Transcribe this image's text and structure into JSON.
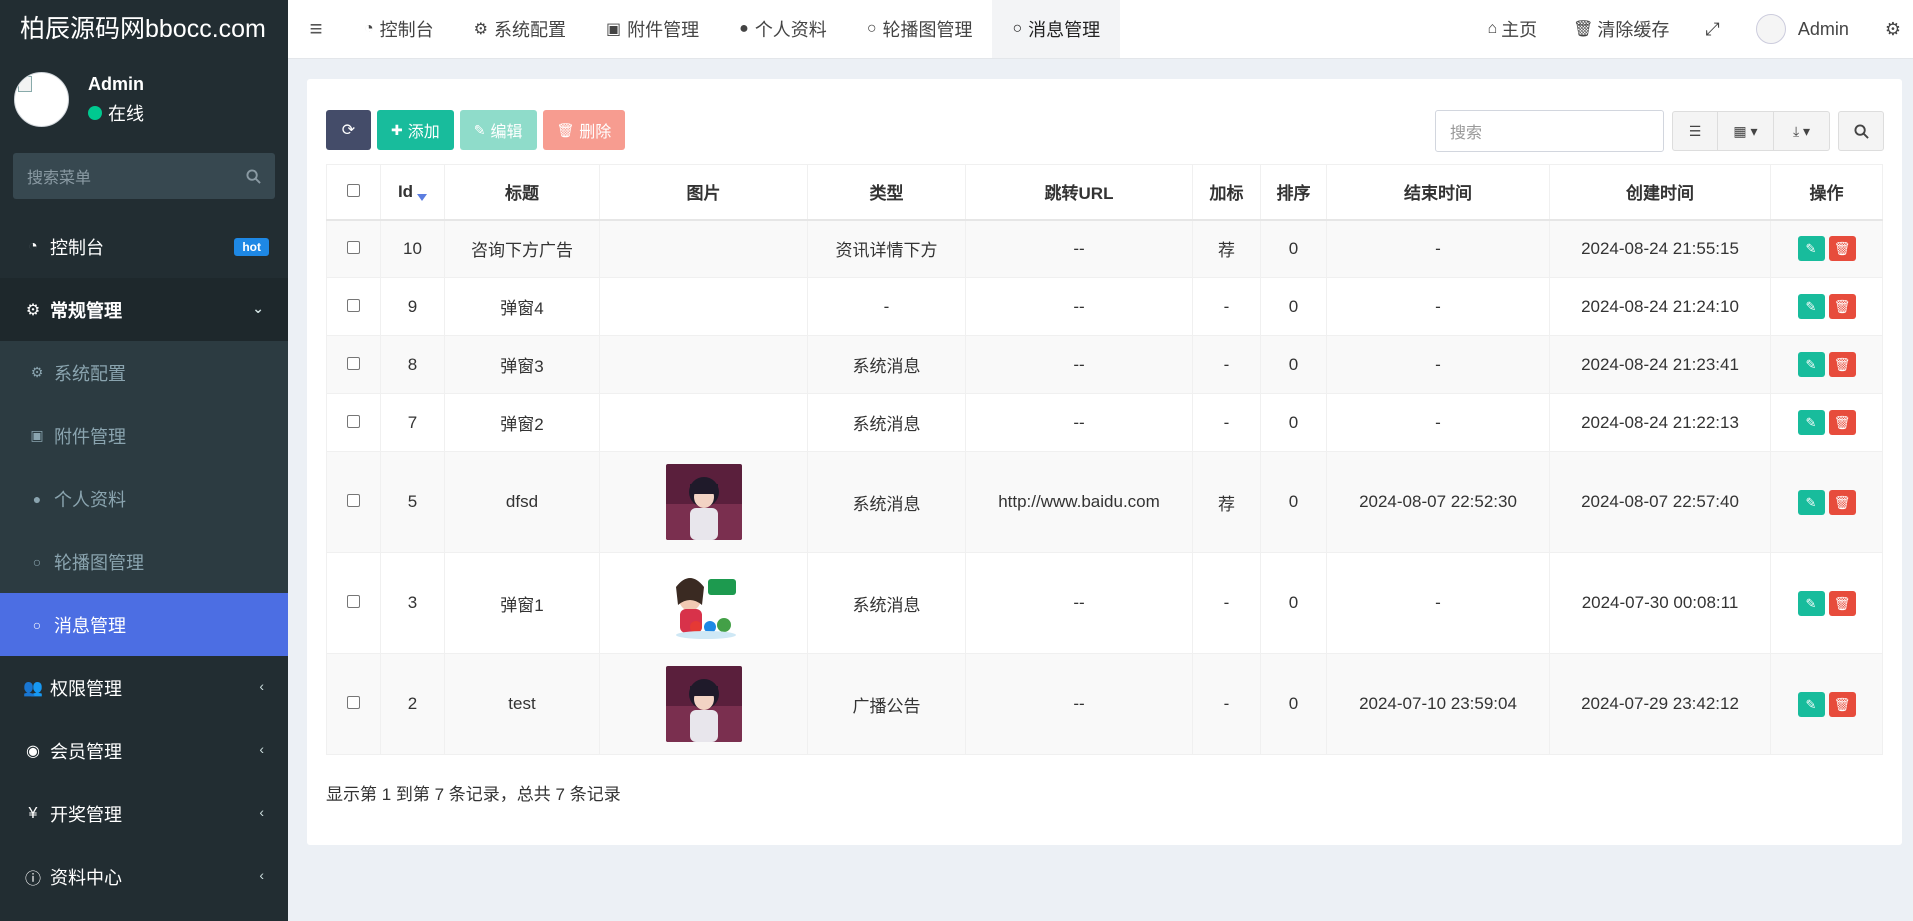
{
  "app": {
    "logo_text": "柏辰源码网bbocc.com"
  },
  "user": {
    "name": "Admin",
    "status": "在线"
  },
  "sidebar": {
    "search_placeholder": "搜索菜单",
    "items": [
      {
        "label": "控制台",
        "icon": "dashboard-icon",
        "badge": "hot"
      },
      {
        "label": "常规管理",
        "icon": "cogs-icon",
        "open": true
      },
      {
        "label": "权限管理",
        "icon": "users-icon"
      },
      {
        "label": "会员管理",
        "icon": "user-circle-icon"
      },
      {
        "label": "开奖管理",
        "icon": "yen-icon"
      },
      {
        "label": "资料中心",
        "icon": "info-circle-icon"
      }
    ],
    "sub_items": [
      {
        "label": "系统配置",
        "icon": "gear-icon"
      },
      {
        "label": "附件管理",
        "icon": "image-icon"
      },
      {
        "label": "个人资料",
        "icon": "user-icon"
      },
      {
        "label": "轮播图管理",
        "icon": "circle-icon"
      },
      {
        "label": "消息管理",
        "icon": "circle-icon",
        "active": true
      }
    ]
  },
  "topbar": {
    "tabs": [
      {
        "label": "控制台",
        "icon": "dashboard-icon"
      },
      {
        "label": "系统配置",
        "icon": "gear-icon"
      },
      {
        "label": "附件管理",
        "icon": "image-icon"
      },
      {
        "label": "个人资料",
        "icon": "user-icon"
      },
      {
        "label": "轮播图管理",
        "icon": "circle-icon"
      },
      {
        "label": "消息管理",
        "icon": "circle-icon",
        "active": true
      }
    ],
    "home_label": "主页",
    "clear_cache_label": "清除缓存",
    "admin_label": "Admin"
  },
  "toolbar": {
    "add_label": "添加",
    "edit_label": "编辑",
    "delete_label": "删除",
    "search_placeholder": "搜索"
  },
  "table": {
    "columns": [
      "Id",
      "标题",
      "图片",
      "类型",
      "跳转URL",
      "加标",
      "排序",
      "结束时间",
      "创建时间",
      "操作"
    ],
    "rows": [
      {
        "id": "10",
        "title": "咨询下方广告",
        "image": "",
        "type": "资讯详情下方",
        "url": "--",
        "tag": "荐",
        "sort": "0",
        "end": "-",
        "created": "2024-08-24 21:55:15"
      },
      {
        "id": "9",
        "title": "弹窗4",
        "image": "",
        "type": "-",
        "url": "--",
        "tag": "-",
        "sort": "0",
        "end": "-",
        "created": "2024-08-24 21:24:10"
      },
      {
        "id": "8",
        "title": "弹窗3",
        "image": "",
        "type": "系统消息",
        "url": "--",
        "tag": "-",
        "sort": "0",
        "end": "-",
        "created": "2024-08-24 21:23:41"
      },
      {
        "id": "7",
        "title": "弹窗2",
        "image": "",
        "type": "系统消息",
        "url": "--",
        "tag": "-",
        "sort": "0",
        "end": "-",
        "created": "2024-08-24 21:22:13"
      },
      {
        "id": "5",
        "title": "dfsd",
        "image": "anime-girl",
        "type": "系统消息",
        "url": "http://www.baidu.com",
        "tag": "荐",
        "sort": "0",
        "end": "2024-08-07 22:52:30",
        "created": "2024-08-07 22:57:40"
      },
      {
        "id": "3",
        "title": "弹窗1",
        "image": "lottery-promo",
        "type": "系统消息",
        "url": "--",
        "tag": "-",
        "sort": "0",
        "end": "-",
        "created": "2024-07-30 00:08:11"
      },
      {
        "id": "2",
        "title": "test",
        "image": "anime-girl",
        "type": "广播公告",
        "url": "--",
        "tag": "-",
        "sort": "0",
        "end": "2024-07-10 23:59:04",
        "created": "2024-07-29 23:42:12"
      }
    ]
  },
  "pagination": {
    "summary": "显示第 1 到第 7 条记录，总共 7 条记录"
  },
  "colors": {
    "sidebar_bg": "#222d32",
    "active_menu": "#4c6ee3",
    "success": "#18bc9c",
    "danger": "#e74c3c"
  }
}
